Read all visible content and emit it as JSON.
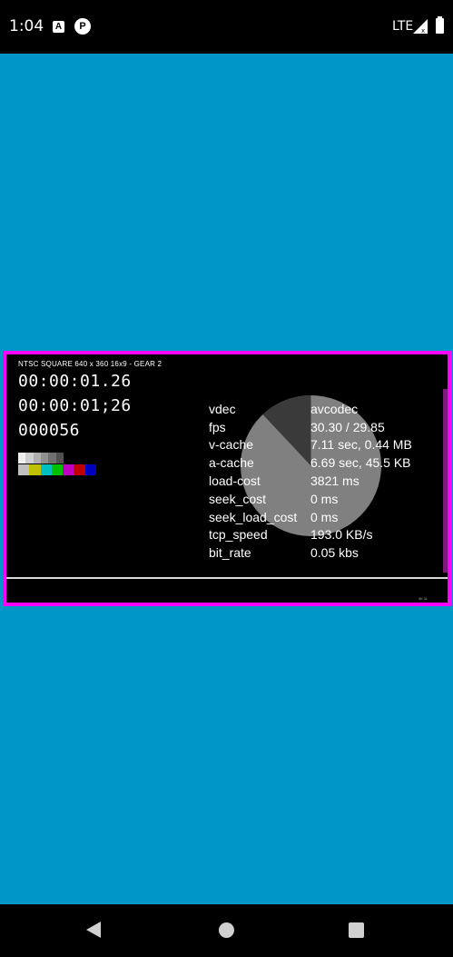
{
  "status_bar": {
    "time": "1:04",
    "notification_icons": [
      "a-icon",
      "p-icon"
    ],
    "network": "LTE",
    "signal_icon": "signal-no-data-icon",
    "battery_icon": "battery-full-icon"
  },
  "colors": {
    "app_background": "#0096C8",
    "player_border": "#FF00FF",
    "player_background": "#000000",
    "pie_main": "#808080",
    "pie_slice": "#3a3a3a"
  },
  "player": {
    "caption": "NTSC SQUARE  640 x 360  16x9  -  GEAR 2",
    "timecode_1": "00:00:01.26",
    "timecode_2": "00:00:01;26",
    "frame_counter": "000056",
    "tiny_label": "4K 11",
    "grayscale_swatches": [
      "#f0f0f0",
      "#cfcfcf",
      "#b0b0b0",
      "#909090",
      "#707070",
      "#505050"
    ],
    "color_bars": [
      "#c0c0c0",
      "#c0c000",
      "#00c0c0",
      "#00c000",
      "#c000c0",
      "#c00000",
      "#0000c0"
    ],
    "stats": [
      {
        "key": "vdec",
        "value": "avcodec"
      },
      {
        "key": "fps",
        "value": "30.30 / 29.85"
      },
      {
        "key": "v-cache",
        "value": "7.11 sec, 0.44 MB"
      },
      {
        "key": "a-cache",
        "value": "6.69 sec, 45.5 KB"
      },
      {
        "key": "load-cost",
        "value": "3821 ms"
      },
      {
        "key": "seek_cost",
        "value": "0 ms"
      },
      {
        "key": "seek_load_cost",
        "value": "0 ms"
      },
      {
        "key": "tcp_speed",
        "value": "193.0 KB/s"
      },
      {
        "key": "bit_rate",
        "value": "0.05 kbs"
      }
    ],
    "pie_progress_fraction": 0.12
  },
  "nav_bar": {
    "back_icon": "back-triangle-icon",
    "home_icon": "home-circle-icon",
    "recents_icon": "recents-square-icon"
  }
}
